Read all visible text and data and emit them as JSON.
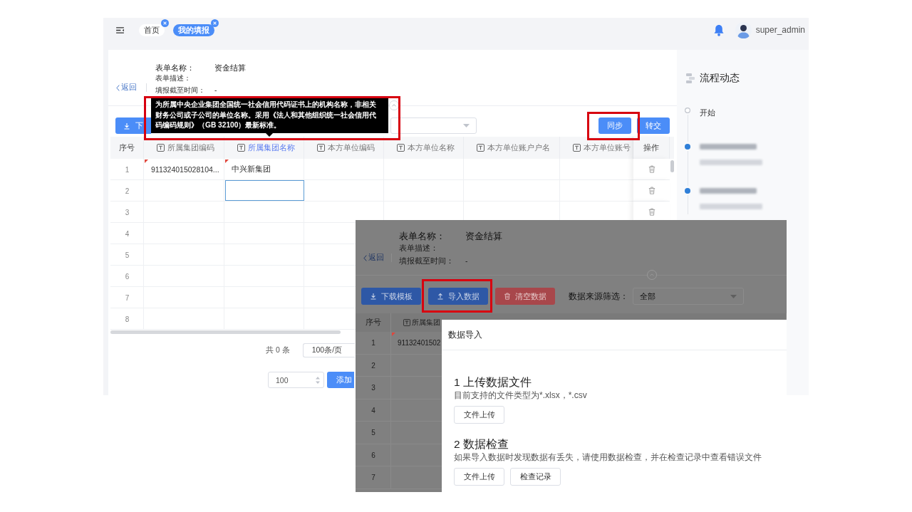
{
  "header": {
    "tabs": [
      {
        "label": "首页",
        "selected": false
      },
      {
        "label": "我的填报",
        "selected": true
      }
    ],
    "user": "super_admin"
  },
  "form_info": {
    "back": "返回",
    "fields": [
      {
        "label": "表单名称：",
        "value": "资金结算",
        "kind": "title"
      },
      {
        "label": "表单描述：",
        "kind": "plain"
      },
      {
        "label": "填报截至时间：",
        "value": "-",
        "kind": "plain"
      }
    ]
  },
  "toolbar": {
    "download_button": "下",
    "actions": [
      "同步",
      "转交"
    ]
  },
  "tooltip": "为所属中央企业集团全国统一社会信用代码证书上的机构名称，非相关财务公司或子公司的单位名称。采用《法人和其他组织统一社会信用代码编码规则》（GB 32100）最新标准。",
  "table": {
    "columns": [
      {
        "label": "序号",
        "kind": "index",
        "hovered": false
      },
      {
        "label": "所属集团编码",
        "kind": "text",
        "hovered": false
      },
      {
        "label": "所属集团名称",
        "kind": "text",
        "hovered": true
      },
      {
        "label": "本方单位编码",
        "kind": "text",
        "hovered": false
      },
      {
        "label": "本方单位名称",
        "kind": "text",
        "hovered": false
      },
      {
        "label": "本方单位账户户名",
        "kind": "text",
        "hovered": false
      },
      {
        "label": "本方单位账号",
        "kind": "text",
        "hovered": false
      },
      {
        "label": "操作",
        "kind": "action",
        "hovered": false
      }
    ],
    "rows": [
      {
        "index": "1",
        "cells": [
          {
            "text": "911324015028104...",
            "flagged": true,
            "selected": false
          },
          {
            "text": "中兴新集团",
            "flagged": true,
            "selected": false
          }
        ],
        "delete_icon": true
      },
      {
        "index": "2",
        "cells": [
          {
            "flagged": false,
            "selected": false
          },
          {
            "flagged": false,
            "selected": true
          }
        ],
        "delete_icon": true
      },
      {
        "index": "3",
        "delete_icon": true
      },
      {
        "index": "4",
        "delete_icon": false
      },
      {
        "index": "5",
        "delete_icon": false
      },
      {
        "index": "6",
        "delete_icon": false
      },
      {
        "index": "7",
        "delete_icon": false
      },
      {
        "index": "8",
        "delete_icon": false
      }
    ]
  },
  "pagination": {
    "total": "共 0 条",
    "page_size": "100条/页",
    "row_count": "100",
    "add_button": "添加"
  },
  "sidebar": {
    "title": "流程动态",
    "timeline": [
      {
        "kind": "start",
        "label": "开始"
      },
      {
        "kind": "redacted"
      },
      {
        "kind": "redacted"
      }
    ]
  },
  "overlay": {
    "form_info": {
      "back": "返回",
      "fields": [
        {
          "label": "表单名称：",
          "value": "资金结算",
          "kind": "title"
        },
        {
          "label": "表单描述：",
          "kind": "plain"
        },
        {
          "label": "填报截至时间：",
          "value": "-",
          "kind": "plain"
        }
      ]
    },
    "toolbar": {
      "buttons": [
        {
          "label": "下载模板",
          "kind": "download"
        },
        {
          "label": "导入数据",
          "kind": "import"
        },
        {
          "label": "清空数据",
          "kind": "clear"
        }
      ],
      "filter": {
        "label": "数据来源筛选：",
        "value": "全部"
      }
    },
    "table": {
      "columns": [
        {
          "label": "序号",
          "kind": "index"
        },
        {
          "label": "所属集团",
          "kind": "text"
        }
      ],
      "rows": [
        {
          "index": "1",
          "cells": [
            {
              "text": "91132401502",
              "flagged": true
            }
          ]
        },
        {
          "index": "2"
        },
        {
          "index": "3"
        },
        {
          "index": "4"
        },
        {
          "index": "5"
        },
        {
          "index": "6"
        },
        {
          "index": "7"
        }
      ]
    },
    "dialog": {
      "title": "数据导入",
      "sections": [
        {
          "heading": "1 上传数据文件",
          "description": "目前支持的文件类型为*.xlsx，*.csv",
          "buttons": [
            "文件上传"
          ]
        },
        {
          "heading": "2 数据检查",
          "description": "如果导入数据时发现数据有丢失，请使用数据检查，并在检查记录中查看错误文件",
          "buttons": [
            "文件上传",
            "检查记录"
          ]
        }
      ]
    }
  }
}
